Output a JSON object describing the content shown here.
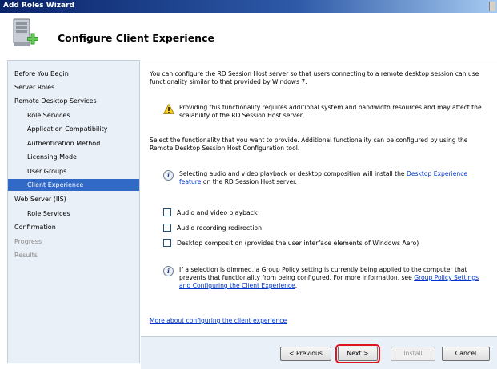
{
  "window": {
    "title": "Add Roles Wizard"
  },
  "header": {
    "title": "Configure Client Experience",
    "icon": "server-add-icon"
  },
  "sidebar": {
    "items": [
      {
        "label": "Before You Begin",
        "level": 0,
        "state": "normal"
      },
      {
        "label": "Server Roles",
        "level": 0,
        "state": "normal"
      },
      {
        "label": "Remote Desktop Services",
        "level": 0,
        "state": "normal"
      },
      {
        "label": "Role Services",
        "level": 1,
        "state": "normal"
      },
      {
        "label": "Application Compatibility",
        "level": 1,
        "state": "normal"
      },
      {
        "label": "Authentication Method",
        "level": 1,
        "state": "normal"
      },
      {
        "label": "Licensing Mode",
        "level": 1,
        "state": "normal"
      },
      {
        "label": "User Groups",
        "level": 1,
        "state": "normal"
      },
      {
        "label": "Client Experience",
        "level": 1,
        "state": "selected"
      },
      {
        "label": "Web Server (IIS)",
        "level": 0,
        "state": "normal"
      },
      {
        "label": "Role Services",
        "level": 1,
        "state": "normal"
      },
      {
        "label": "Confirmation",
        "level": 0,
        "state": "normal"
      },
      {
        "label": "Progress",
        "level": 0,
        "state": "disabled"
      },
      {
        "label": "Results",
        "level": 0,
        "state": "disabled"
      }
    ]
  },
  "content": {
    "intro": "You can configure the RD Session Host server so that users connecting to a remote desktop session can use functionality similar to that provided by Windows 7.",
    "warning": "Providing this functionality requires additional system and bandwidth resources and may affect the scalability of the RD Session Host server.",
    "select_text": "Select the functionality that you want to provide. Additional functionality can be configured by using the Remote Desktop Session Host Configuration tool.",
    "info1_pre": "Selecting audio and video playback or desktop composition will install the ",
    "info1_link": "Desktop Experience feature",
    "info1_post": " on the RD Session Host server.",
    "checkboxes": [
      {
        "label": "Audio and video playback",
        "checked": false
      },
      {
        "label": "Audio recording redirection",
        "checked": false
      },
      {
        "label": "Desktop composition (provides the user interface elements of Windows Aero)",
        "checked": false
      }
    ],
    "info2_pre": "If a selection is dimmed, a Group Policy setting is currently being applied to the computer that prevents that functionality from being configured. For more information, see ",
    "info2_link": "Group Policy Settings and Configuring the Client Experience",
    "info2_post": ".",
    "more_link": "More about configuring the client experience"
  },
  "footer": {
    "previous": "< Previous",
    "next": "Next >",
    "install": "Install",
    "cancel": "Cancel"
  },
  "colors": {
    "selected": "#3169c6",
    "sidebar_bg": "#eaf0f7",
    "link": "#0033cc",
    "focus_highlight": "#e0141e"
  }
}
